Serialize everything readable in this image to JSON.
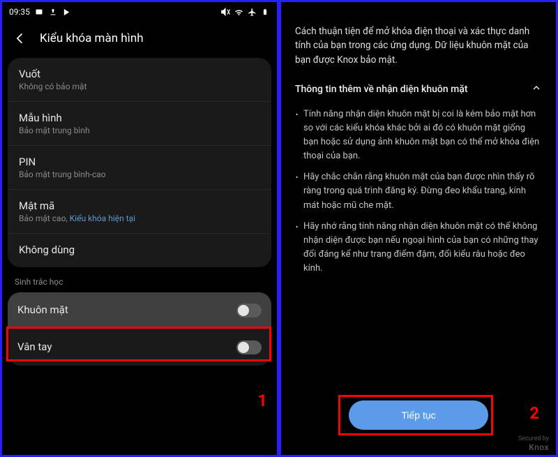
{
  "status": {
    "time": "09:35"
  },
  "left": {
    "title": "Kiểu khóa màn hình",
    "items": [
      {
        "title": "Vuốt",
        "sub": "Không có bảo mật"
      },
      {
        "title": "Mẫu hình",
        "sub": "Bảo mật trung bình"
      },
      {
        "title": "PIN",
        "sub": "Bảo mật trung bình-cao"
      },
      {
        "title": "Mật mã",
        "sub": "Bảo mật cao, ",
        "current": "Kiểu khóa hiện tại"
      },
      {
        "title": "Không dùng",
        "sub": ""
      }
    ],
    "section": "Sinh trắc học",
    "biometric": [
      {
        "title": "Khuôn mặt"
      },
      {
        "title": "Vân tay"
      }
    ],
    "step": "1"
  },
  "right": {
    "intro": "Cách thuận tiện để mở khóa điện thoại và xác thực danh tính của bạn trong các ứng dụng. Dữ liệu khuôn mặt của bạn được Knox bảo mật.",
    "more": "Thông tin thêm về nhận diện khuôn mặt",
    "bullets": [
      "Tính năng nhận diện khuôn mặt bị coi là kém bảo mật hơn so với các kiểu khóa khác bởi ai đó có khuôn mặt giống bạn hoặc sử dụng ảnh khuôn mặt bạn có thể mở khóa điện thoại của bạn.",
      "Hãy chắc chắn rằng khuôn mặt của bạn được nhìn thấy rõ ràng trong quá trình đăng ký. Đừng đeo khẩu trang, kính mát hoặc mũ che mặt.",
      "Hãy nhớ rằng tính năng nhận diện khuôn mặt có thể không nhận diện được bạn nếu ngoại hình của bạn có những thay đổi đáng kể như trang điểm đậm, đổi kiểu râu hoặc đeo kính."
    ],
    "continue": "Tiếp tục",
    "step": "2",
    "knox_top": "Secured by",
    "knox": "Knox"
  }
}
